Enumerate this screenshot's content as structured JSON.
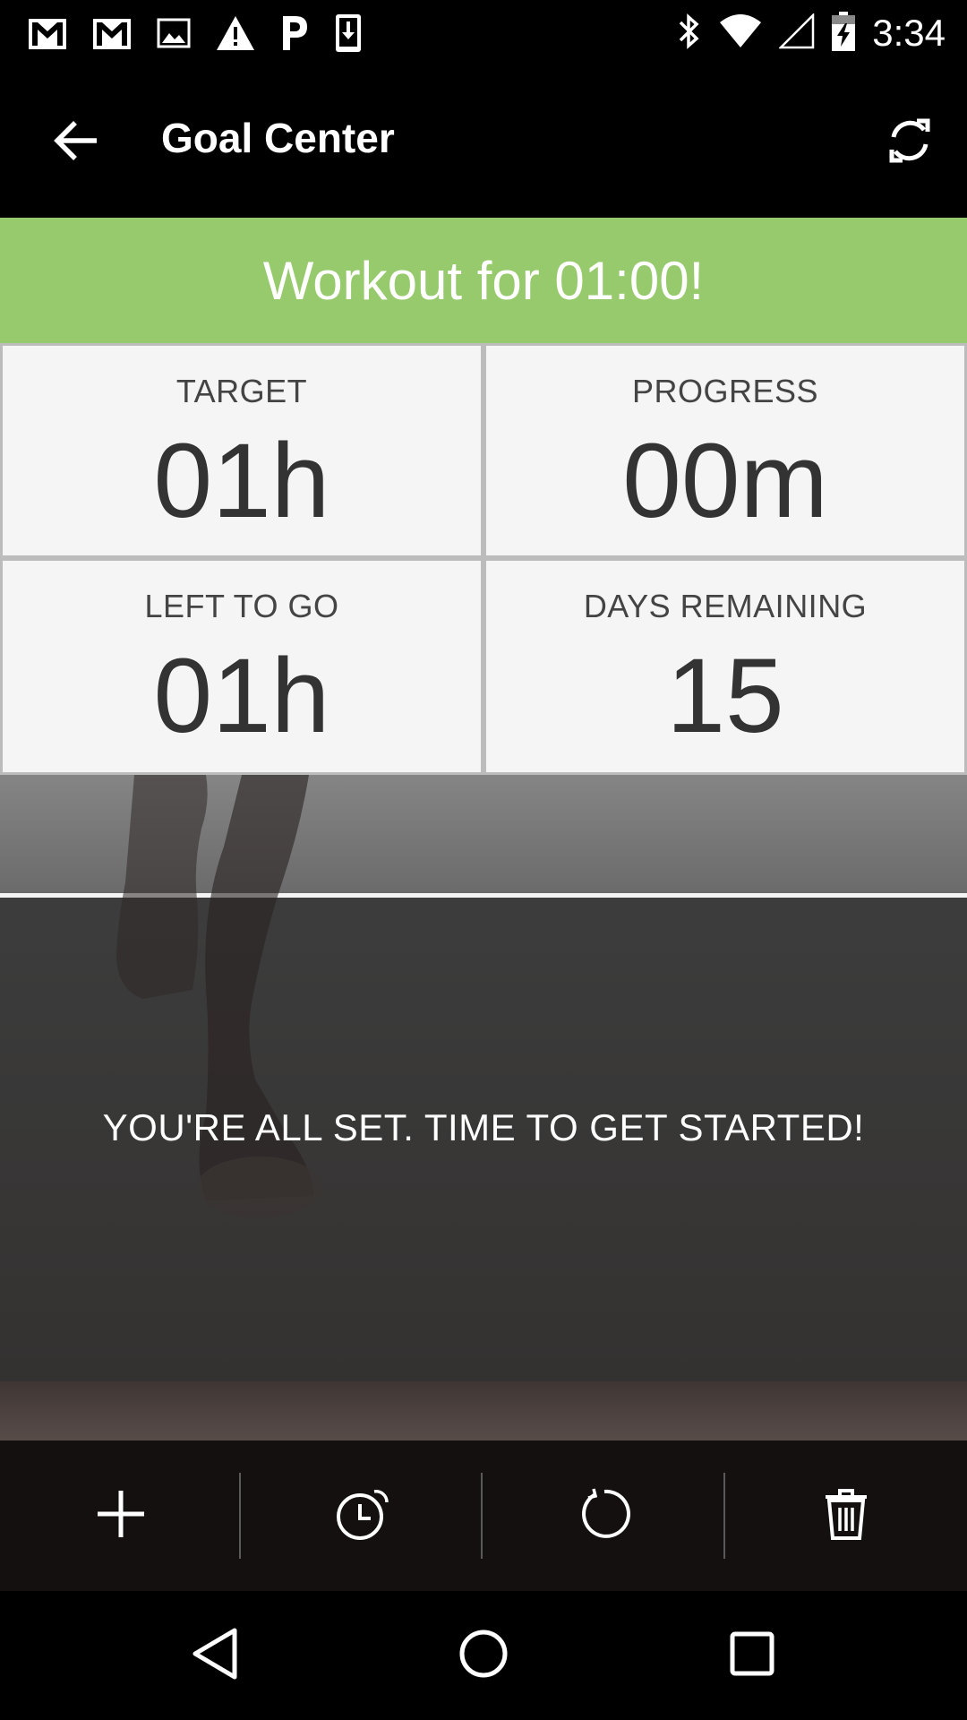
{
  "status_bar": {
    "time": "3:34",
    "notification_icons": [
      "gmail-icon",
      "gmail-icon",
      "image-icon",
      "warning-icon",
      "parking-icon",
      "download-icon"
    ],
    "system_icons": [
      "bluetooth-icon",
      "wifi-icon",
      "signal-icon",
      "battery-charging-icon"
    ]
  },
  "toolbar": {
    "title": "Goal Center",
    "back_icon": "arrow-back-icon",
    "refresh_icon": "refresh-icon"
  },
  "goal": {
    "banner": "Workout for 01:00!"
  },
  "stats": [
    {
      "label": "TARGET",
      "value": "01h"
    },
    {
      "label": "PROGRESS",
      "value": "00m"
    },
    {
      "label": "LEFT TO GO",
      "value": "01h"
    },
    {
      "label": "DAYS REMAINING",
      "value": "15"
    }
  ],
  "hero": {
    "message": "YOU'RE ALL SET. TIME TO GET STARTED!"
  },
  "actions": [
    "add-icon",
    "alarm-clock-icon",
    "reset-icon",
    "trash-icon"
  ],
  "nav": [
    "nav-back-icon",
    "nav-home-icon",
    "nav-recents-icon"
  ],
  "colors": {
    "accent_green": "#97c96d",
    "card_background": "#f5f5f5",
    "action_bar": "#141010"
  }
}
